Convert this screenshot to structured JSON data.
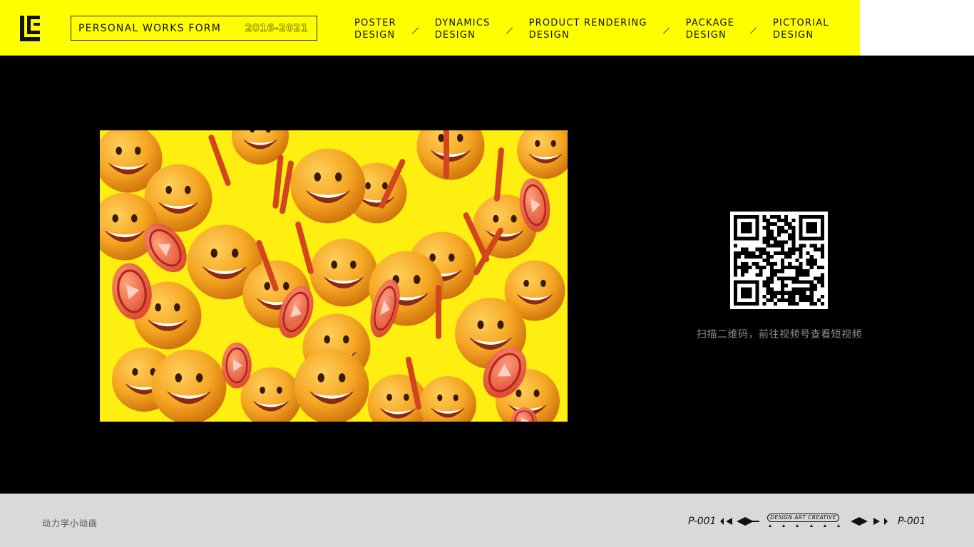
{
  "header": {
    "title": "PERSONAL WORKS FORM",
    "years": "2016-2021",
    "nav": [
      {
        "line1": "POSTER",
        "line2": "DESIGN"
      },
      {
        "line1": "DYNAMICS",
        "line2": "DESIGN"
      },
      {
        "line1": "PRODUCT RENDERING",
        "line2": "DESIGN"
      },
      {
        "line1": "PACKAGE",
        "line2": "DESIGN"
      },
      {
        "line1": "PICTORIAL",
        "line2": "DESIGN"
      }
    ]
  },
  "main": {
    "qr_caption": "扫描二维码，前往视频号查看短视频"
  },
  "footer": {
    "label": "动力学小动画",
    "page_left": "P-001",
    "page_right": "P-001",
    "badge": "DESIGN ART CREATIVE"
  },
  "colors": {
    "accent": "#ffff00",
    "background": "#000000",
    "footer": "#d9d9d9"
  }
}
